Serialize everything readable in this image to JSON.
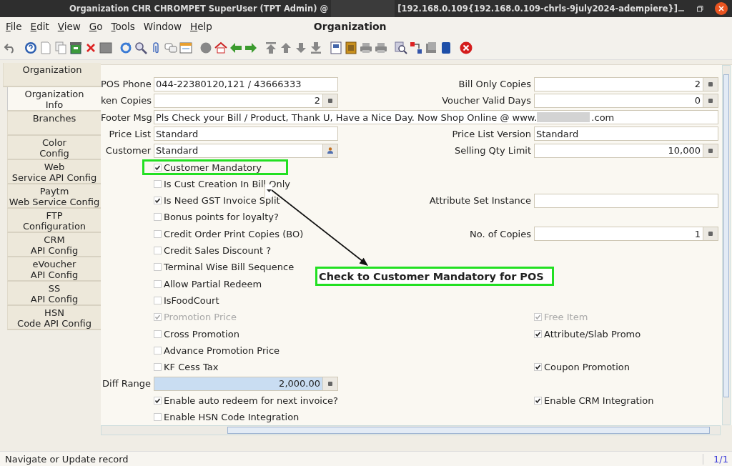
{
  "window": {
    "title": "Organization  CHR  CHROMPET  SuperUser (TPT Admin) @",
    "title_suffix": "[192.168.0.109{192.168.0.109-chrls-9july2024-adempiere}]"
  },
  "menu": [
    {
      "label": "File",
      "mnemonic": true
    },
    {
      "label": "Edit",
      "mnemonic": true
    },
    {
      "label": "View",
      "mnemonic": true
    },
    {
      "label": "Go",
      "mnemonic": true
    },
    {
      "label": "Tools",
      "mnemonic": true
    },
    {
      "label": "Window",
      "mnemonic": false
    },
    {
      "label": "Help",
      "mnemonic": true
    }
  ],
  "screen_title": "Organization",
  "tabs": [
    {
      "label": "Organization",
      "selected": false
    },
    {
      "label": "Organization\nInfo",
      "selected": true
    },
    {
      "label": "Branches",
      "selected": false
    },
    {
      "label": "Color\nConfig",
      "selected": false
    },
    {
      "label": "Web\nService API Config",
      "selected": false
    },
    {
      "label": "Paytm\nWeb Service Config",
      "selected": false
    },
    {
      "label": "FTP\nConfiguration",
      "selected": false
    },
    {
      "label": "CRM\nAPI Config",
      "selected": false
    },
    {
      "label": "eVoucher\nAPI Config",
      "selected": false
    },
    {
      "label": "SS\nAPI Config",
      "selected": false
    },
    {
      "label": "HSN\nCode API Config",
      "selected": false
    }
  ],
  "form": {
    "rows": [
      {
        "left": {
          "kind": "text_field",
          "label": "POS Phone",
          "value": "044-22380120,121 / 43666333",
          "focused": false
        },
        "right": {
          "kind": "number_field",
          "label": "Bill Only Copies",
          "value": "2",
          "focused": false
        }
      },
      {
        "left": {
          "kind": "number_field",
          "label": "ken Copies",
          "value": "2",
          "focused": false
        },
        "right": {
          "kind": "number_field",
          "label": "Voucher Valid Days",
          "value": "0",
          "focused": false
        }
      },
      {
        "left": {
          "kind": "wide_field",
          "label": "Footer Msg",
          "value_parts": [
            "Pls Check your Bill / Product, Thank U, Have a Nice Day. Now Shop Online @ www.",
            ".com"
          ]
        }
      },
      {
        "left": {
          "kind": "combo_field",
          "label": "Price List",
          "value": "Standard",
          "focused": false
        },
        "right": {
          "kind": "combo_field",
          "label": "Price List Version",
          "value": "Standard",
          "focused": false
        }
      },
      {
        "left": {
          "kind": "search_field",
          "label": "Customer",
          "value": "Standard",
          "focused": false
        },
        "right": {
          "kind": "number_field",
          "label": "Selling Qty Limit",
          "value": "10,000",
          "focused": false
        }
      },
      {
        "left": {
          "kind": "checkbox",
          "label": "Customer Mandatory",
          "checked": true,
          "disabled": false,
          "highlighted": true
        }
      },
      {
        "left": {
          "kind": "checkbox",
          "label": "Is Cust Creation In Bill Only",
          "checked": false,
          "disabled": false
        }
      },
      {
        "left": {
          "kind": "checkbox",
          "label": "Is Need GST Invoice Split",
          "checked": true,
          "disabled": false
        },
        "right": {
          "kind": "combo_field",
          "label": "Attribute Set Instance",
          "focused": false
        }
      },
      {
        "left": {
          "kind": "checkbox",
          "label": "Bonus points for loyalty?",
          "checked": false,
          "disabled": false
        }
      },
      {
        "left": {
          "kind": "checkbox",
          "label": "Credit Order Print Copies (BO)",
          "checked": false,
          "disabled": false
        },
        "right": {
          "kind": "number_field",
          "label": "No. of Copies",
          "value": "1",
          "focused": false
        }
      },
      {
        "left": {
          "kind": "checkbox",
          "label": "Credit Sales Discount ?",
          "checked": false,
          "disabled": false
        }
      },
      {
        "left": {
          "kind": "checkbox",
          "label": "Terminal Wise Bill Sequence",
          "checked": false,
          "disabled": false
        }
      },
      {
        "left": {
          "kind": "checkbox",
          "label": "Allow Partial Redeem",
          "checked": false,
          "disabled": false
        }
      },
      {
        "left": {
          "kind": "checkbox",
          "label": "IsFoodCourt",
          "checked": false,
          "disabled": false
        }
      },
      {
        "left": {
          "kind": "checkbox",
          "label": "Promotion Price",
          "checked": true,
          "disabled": true
        },
        "right": {
          "kind": "checkbox",
          "label": "Free Item",
          "checked": true,
          "disabled": true
        }
      },
      {
        "left": {
          "kind": "checkbox",
          "label": "Cross Promotion",
          "checked": false,
          "disabled": false
        },
        "right": {
          "kind": "checkbox",
          "label": "Attribute/Slab Promo",
          "checked": true,
          "disabled": false
        }
      },
      {
        "left": {
          "kind": "checkbox",
          "label": "Advance Promotion Price",
          "checked": false,
          "disabled": false
        }
      },
      {
        "left": {
          "kind": "checkbox",
          "label": "KF Cess Tax",
          "checked": false,
          "disabled": false
        },
        "right": {
          "kind": "checkbox",
          "label": "Coupon Promotion",
          "checked": true,
          "disabled": false
        }
      },
      {
        "left": {
          "kind": "number_field",
          "label": "Diff Range",
          "value": "2,000.00",
          "focused": true
        }
      },
      {
        "left": {
          "kind": "checkbox",
          "label": "Enable auto redeem for next invoice?",
          "checked": true,
          "disabled": false
        },
        "right": {
          "kind": "checkbox",
          "label": "Enable CRM Integration",
          "checked": true,
          "disabled": false
        }
      },
      {
        "left": {
          "kind": "checkbox",
          "label": "Enable HSN Code Integration",
          "checked": false,
          "disabled": false
        }
      }
    ]
  },
  "annotation": {
    "text": "Check to Customer Mandatory for POS"
  },
  "status_bar": {
    "message": "Navigate or Update record",
    "record": "1/1"
  }
}
